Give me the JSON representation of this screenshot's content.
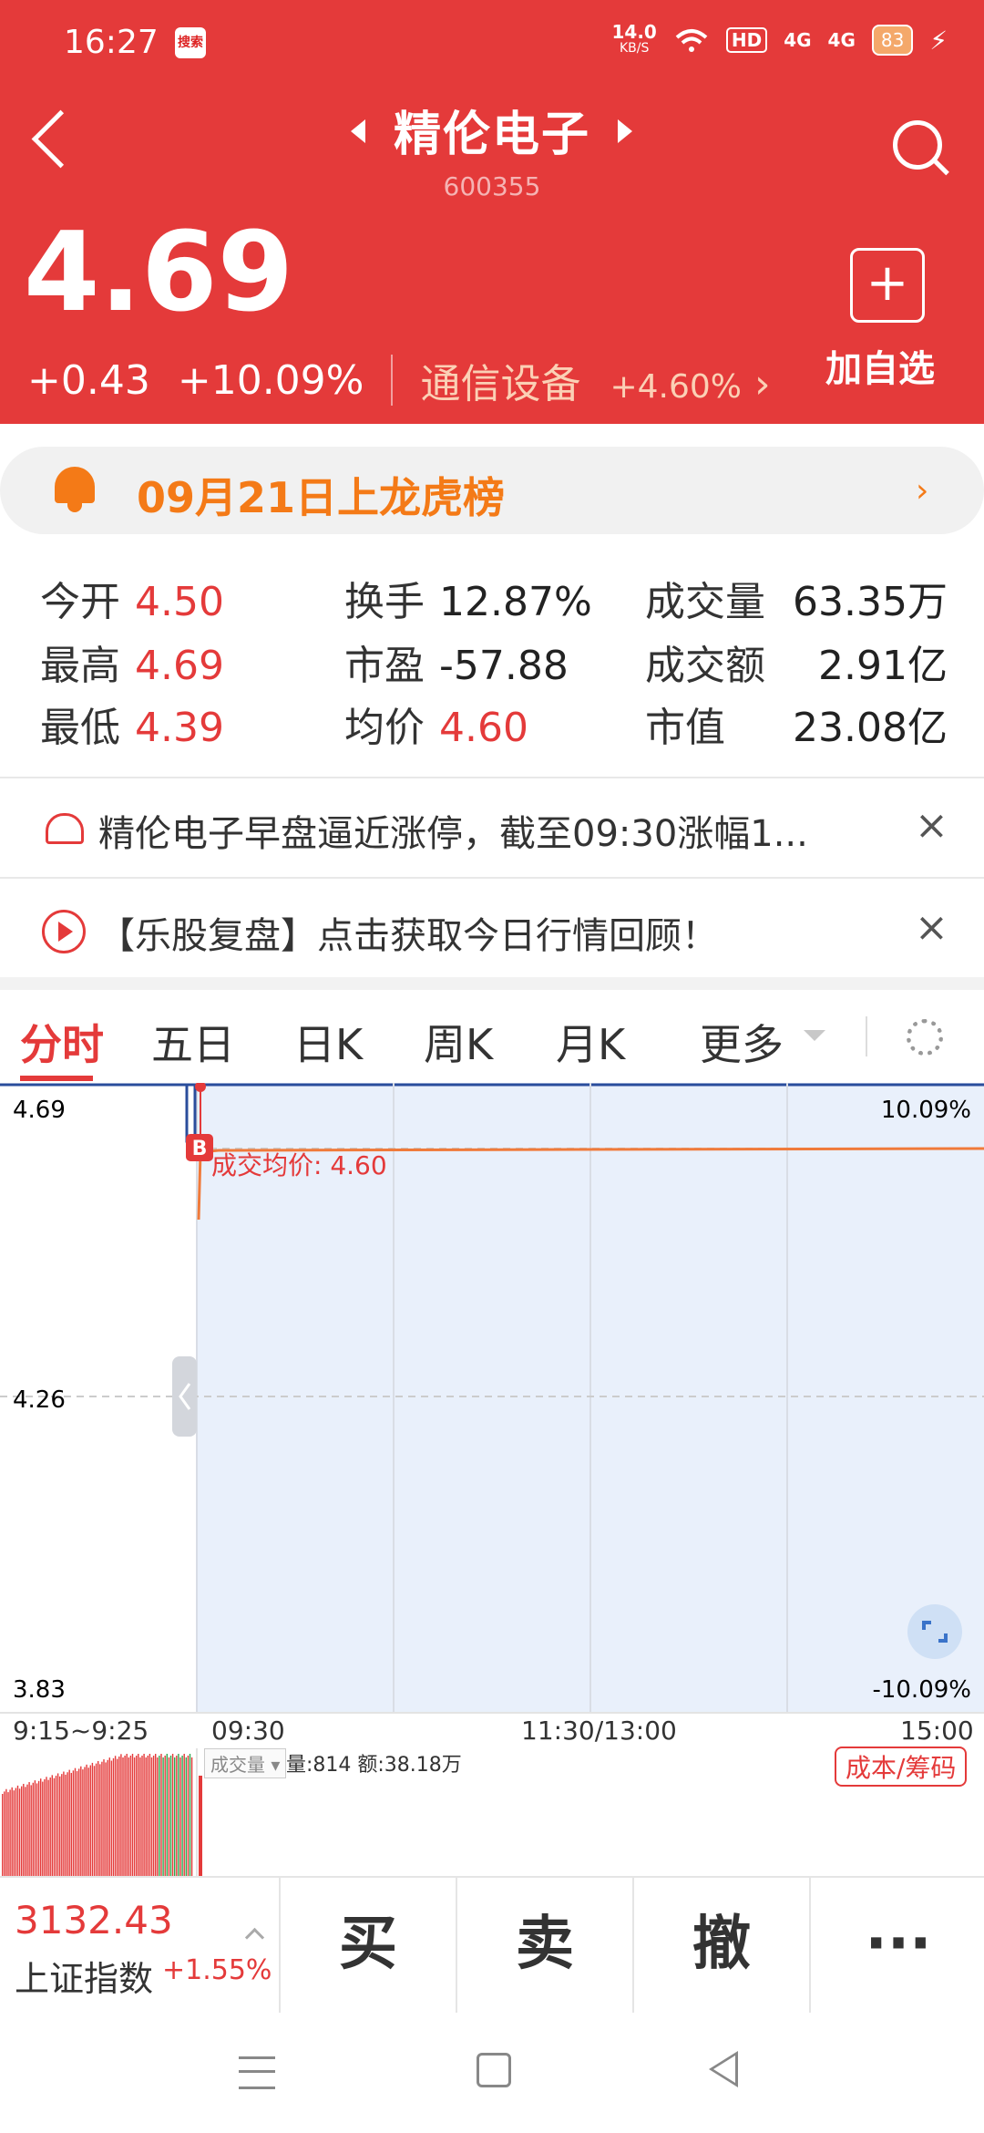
{
  "status": {
    "time": "16:27",
    "app_badge": "搜索",
    "speed": "14.0",
    "speed_unit": "KB/S",
    "hd": "HD",
    "sig1": "4G",
    "sig2": "4G",
    "battery": "83"
  },
  "header": {
    "name": "精伦电子",
    "code": "600355",
    "price": "4.69",
    "change": "+0.43",
    "change_pct": "+10.09%",
    "industry": "通信设备",
    "industry_pct": "+4.60%",
    "add_label": "加自选",
    "add_symbol": "+"
  },
  "alert": {
    "text": "09月21日上龙虎榜",
    "chevron": "›"
  },
  "stats": {
    "open_label": "今开",
    "open": "4.50",
    "high_label": "最高",
    "high": "4.69",
    "low_label": "最低",
    "low": "4.39",
    "turnover_label": "换手",
    "turnover": "12.87%",
    "pe_label": "市盈",
    "pe": "-57.88",
    "avg_label": "均价",
    "avg": "4.60",
    "volume_label": "成交量",
    "volume": "63.35万",
    "amount_label": "成交额",
    "amount": "2.91亿",
    "mktcap_label": "市值",
    "mktcap": "23.08亿"
  },
  "news": [
    {
      "text": "精伦电子早盘逼近涨停，截至09:30涨幅1...",
      "close": "×"
    },
    {
      "text": "【乐股复盘】点击获取今日行情回顾！",
      "close": "×"
    }
  ],
  "tabs": [
    "分时",
    "五日",
    "日K",
    "周K",
    "月K",
    "更多"
  ],
  "chart": {
    "y_top": "4.69",
    "y_mid": "4.26",
    "y_bottom": "3.83",
    "pct_top": "10.09%",
    "pct_bottom": "-10.09%",
    "avg_label": "成交均价: 4.60",
    "b_marker": "B",
    "time_labels": [
      "9:15~9:25",
      "09:30",
      "11:30/13:00",
      "15:00"
    ],
    "colors": {
      "price": "#2a4d9c",
      "avg": "#f07a3a",
      "area": "#e9f0fb"
    }
  },
  "volume": {
    "label": "成交量",
    "text": "量:814 额:38.18万",
    "cost_btn": "成本/筹码"
  },
  "bottom": {
    "index_value": "3132.43",
    "index_name": "上证指数",
    "index_change": "+1.55%",
    "buy": "买",
    "sell": "卖",
    "cancel": "撤",
    "more": "···"
  }
}
